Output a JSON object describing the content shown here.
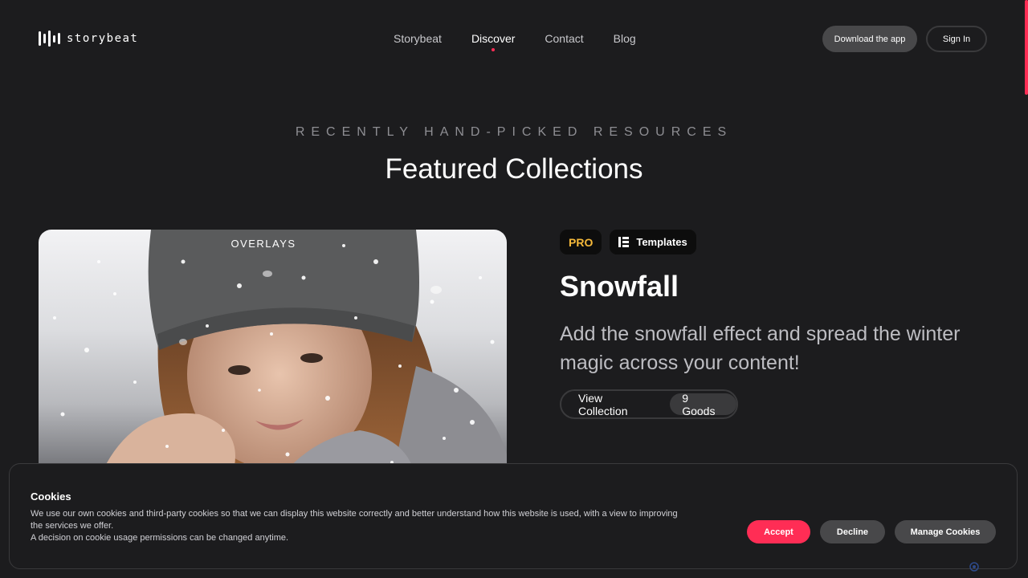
{
  "brand": {
    "name": "storybeat"
  },
  "nav": {
    "items": [
      {
        "label": "Storybeat",
        "active": false
      },
      {
        "label": "Discover",
        "active": true
      },
      {
        "label": "Contact",
        "active": false
      },
      {
        "label": "Blog",
        "active": false
      }
    ]
  },
  "header": {
    "download_label": "Download the app",
    "signin_label": "Sign In"
  },
  "section": {
    "eyebrow": "RECENTLY HAND-PICKED RESOURCES",
    "title": "Featured Collections"
  },
  "collection": {
    "image_label": "OVERLAYS",
    "badge_pro": "PRO",
    "badge_category": "Templates",
    "title": "Snowfall",
    "description": "Add the snowfall effect and spread the winter magic across your content!",
    "view_label": "View Collection",
    "goods_count": "9 Goods"
  },
  "cookie": {
    "title": "Cookies",
    "text_1": "We use our own cookies and third-party cookies so that we can display this website correctly and better understand how this website is used, with a view to improving the services we offer.",
    "text_2": "A decision on cookie usage permissions can be changed anytime.",
    "accept_label": "Accept",
    "decline_label": "Decline",
    "manage_label": "Manage Cookies"
  },
  "colors": {
    "background": "#1c1c1e",
    "accent": "#ff2d55",
    "pro": "#f5b93a",
    "button_gray": "#48484a"
  },
  "icons": {
    "logo": "waveform-logo-icon",
    "category": "list-icon",
    "cookie_settings": "gear-icon"
  }
}
